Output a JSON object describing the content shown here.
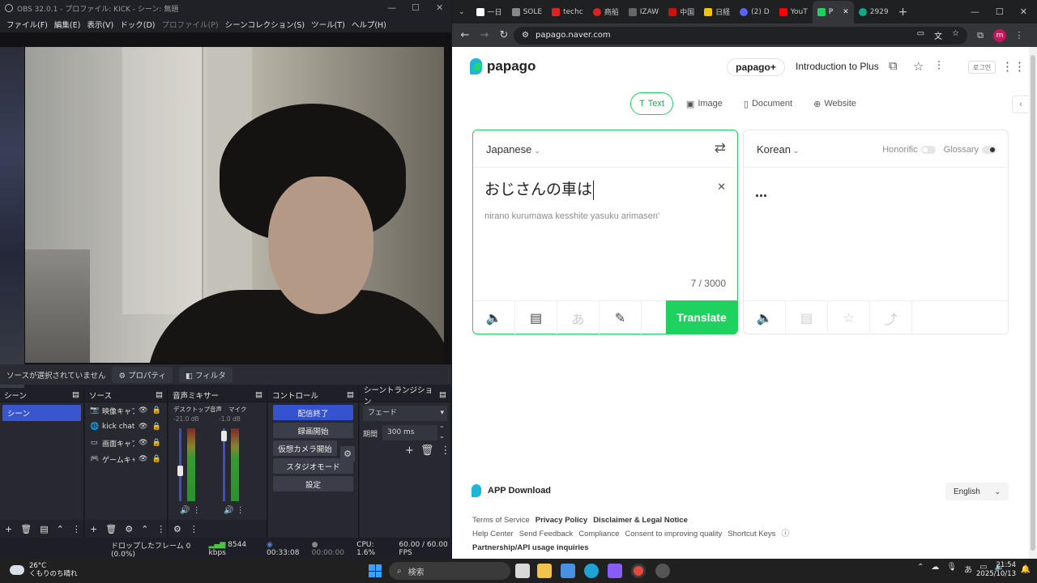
{
  "obs": {
    "title": "OBS 32.0.1 - プロファイル: KICK - シーン: 無題",
    "menu": [
      "ファイル(F)",
      "編集(E)",
      "表示(V)",
      "ドック(D)",
      "プロファイル(P)",
      "シーンコレクション(S)",
      "ツール(T)",
      "ヘルプ(H)"
    ],
    "source_status": "ソースが選択されていません",
    "properties_label": "プロパティ",
    "filters_label": "フィルタ",
    "docks": {
      "scenes": {
        "title": "シーン",
        "items": [
          "シーン"
        ]
      },
      "sources": {
        "title": "ソース",
        "items": [
          "映像キャプ",
          "kick chat",
          "画面キャプ",
          "ゲームキャプ"
        ]
      },
      "mixer": {
        "title": "音声ミキサー",
        "channels": [
          {
            "name": "デスクトップ音声",
            "db": "-21.0 dB",
            "level": 0.45
          },
          {
            "name": "マイク",
            "db": "-1.0 dB",
            "level": 0.96
          }
        ]
      },
      "controls": {
        "title": "コントロール",
        "buttons": [
          "配信終了",
          "録画開始",
          "仮想カメラ開始",
          "スタジオモード",
          "設定"
        ]
      },
      "transitions": {
        "title": "シーントランジション",
        "type": "フェード",
        "duration_label": "期間",
        "duration": "300 ms"
      }
    },
    "status": {
      "dropped": "ドロップしたフレーム 0 (0.0%)",
      "bitrate": "8544 kbps",
      "time": "00:33:08",
      "rec_time": "00:00:00",
      "cpu": "CPU: 1.6%",
      "fps": "60.00 / 60.00 FPS"
    }
  },
  "browser": {
    "tabs": [
      "一日",
      "SOLE",
      "techc",
      "商船",
      "IZAW",
      "中国",
      "日経",
      "(2) D",
      "YouT",
      "P",
      "2929"
    ],
    "active_tab_index": 9,
    "url": "papago.naver.com"
  },
  "papago": {
    "brand": "papago",
    "plus_label": "papago+",
    "intro_label": "Introduction to Plus",
    "login_label": "로그인",
    "modes": [
      "Text",
      "Image",
      "Document",
      "Website"
    ],
    "active_mode": "Text",
    "source_lang": "Japanese",
    "target_lang": "Korean",
    "source_text": "おじさんの車は",
    "romanization": "nirano kurumawa kesshite yasuku arimasen'",
    "char_count": "7 / 3000",
    "translate_label": "Translate",
    "result_text": "...",
    "honorific_label": "Honorific",
    "glossary_label": "Glossary",
    "app_download": "APP Download",
    "language_select": "English",
    "footer": {
      "row1": [
        "Terms of Service",
        "Privacy Policy",
        "Disclaimer & Legal Notice"
      ],
      "row2": [
        "Help Center",
        "Send Feedback",
        "Compliance",
        "Consent to improving quality",
        "Shortcut Keys"
      ],
      "row3": [
        "Partnership/API usage inquiries"
      ]
    }
  },
  "taskbar": {
    "weather_temp": "26°C",
    "weather_text": "くもりのち晴れ",
    "search_placeholder": "検索",
    "ime": "あ",
    "time": "21:54",
    "date": "2025/10/13"
  }
}
